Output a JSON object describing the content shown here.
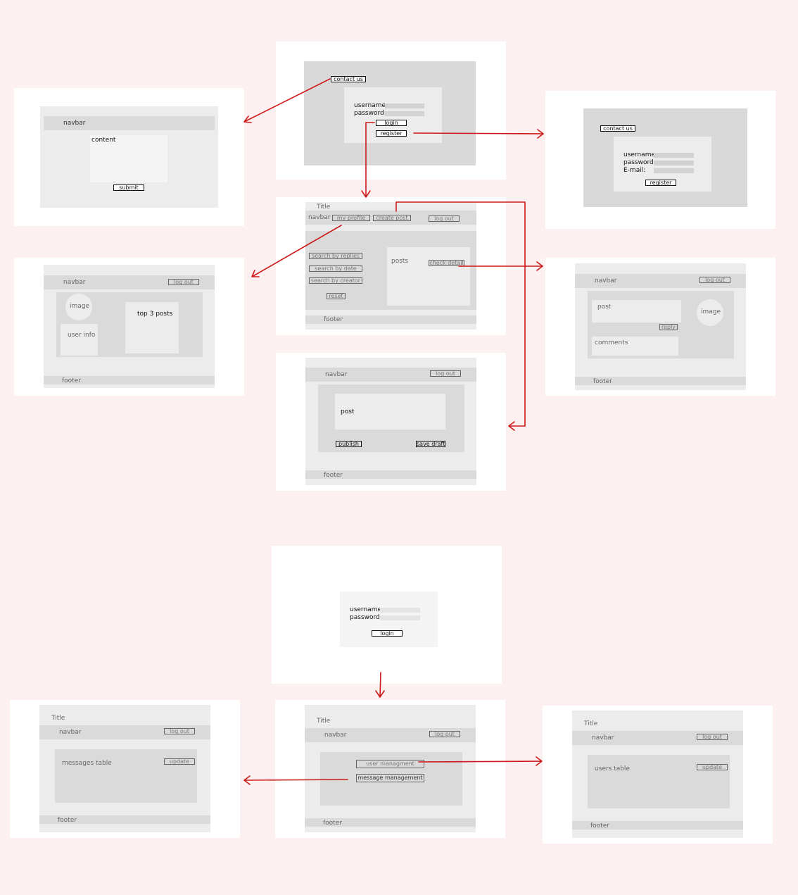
{
  "labels": {
    "contact_us": "contact us",
    "username": "username:",
    "password": "password:",
    "email": "E-mail:",
    "login": "login",
    "register": "register",
    "navbar": "navbar",
    "content": "content",
    "submit": "submit",
    "title": "Title",
    "my_profile": "my profile",
    "create_post": "create post",
    "log_out": "log out",
    "search_by_replies": "search by replies",
    "search_by_date": "search by date",
    "search_by_creator": "search by creator",
    "reset": "reset",
    "posts": "posts",
    "check_detail": "check detail",
    "footer": "footer",
    "image": "image",
    "user_info": "user info",
    "top_3_posts": "top 3 posts",
    "post": "post",
    "reply": "reply",
    "comments": "comments",
    "publish": "publish",
    "save_draft": "save draft",
    "messages_table": "messages  table",
    "update": "update",
    "user_management": "user managment",
    "message_management": "message management",
    "users_table": "users  table"
  },
  "colors": {
    "background": "#fcf1f0",
    "card": "#ffffff",
    "frame": "#ececec",
    "panel": "#d9d9d9",
    "arrow": "#cc1a1a"
  }
}
